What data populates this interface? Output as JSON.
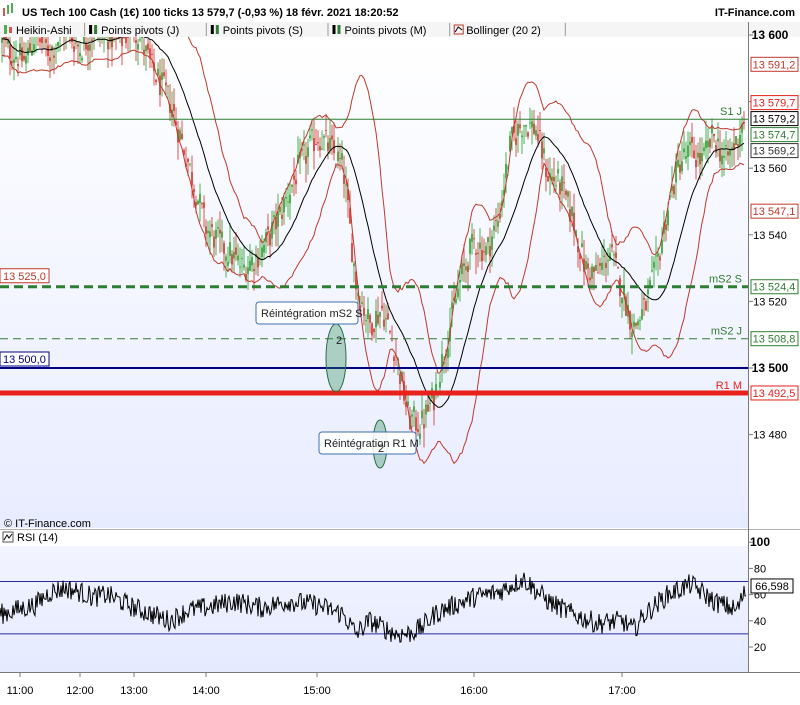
{
  "header": {
    "title": "US Tech 100 Cash (1€) 100 ticks 13 579,7 (-0,93 %) 18 févr. 2021 18:20:52",
    "brand": "IT-Finance.com"
  },
  "legend": [
    {
      "label": "Heikin-Ashi",
      "icon": "heikin-ashi-icon",
      "color": "#2e9e2e"
    },
    {
      "label": "Points pivots (J)",
      "icon": "pivot-icon",
      "color": "#2e7d32"
    },
    {
      "label": "Points pivots (S)",
      "icon": "pivot-icon",
      "color": "#2e7d32"
    },
    {
      "label": "Points pivots (M)",
      "icon": "pivot-icon",
      "color": "#2e7d32"
    },
    {
      "label": "Bollinger (20 2)",
      "icon": "bollinger-icon",
      "color": "#c0392b"
    }
  ],
  "watermark": "© IT-Finance.com",
  "colors": {
    "bull": "#4caf50",
    "bear": "#d9534f",
    "bollinger": "#c0392b",
    "middle": "#000000",
    "pivot_green": "#2e7d32",
    "navy": "#000080",
    "red_level": "#e8211b",
    "plot_bg_top": "#ffffff",
    "plot_bg_bottom": "#e8ecff"
  },
  "chart_data": [
    {
      "type": "candlestick",
      "title": "US Tech 100 Cash (1€) 100 ticks",
      "x_ticks": [
        "11:00",
        "12:00",
        "13:00",
        "14:00",
        "15:00",
        "16:00",
        "17:00"
      ],
      "y_range": [
        13460,
        13610
      ],
      "y_ticks": [
        13480,
        13500,
        13520,
        13540,
        13560,
        13580,
        13600
      ],
      "y_tick_labels": [
        "13 480",
        "13 500",
        "13 520",
        "13 540",
        "13 560",
        "13 580",
        "13 600"
      ],
      "last_price": 13579.7,
      "price_tags": [
        {
          "label": "13 591,2",
          "value": 13591.2,
          "type": "bollinger-upper"
        },
        {
          "label": "13 579,7",
          "value": 13579.7,
          "type": "last-price"
        },
        {
          "label": "13 579,2",
          "value": 13579.2,
          "type": "bollinger-middle"
        },
        {
          "label": "13 574,7",
          "value": 13574.7,
          "type": "pivot"
        },
        {
          "label": "13 569,2",
          "value": 13569.2,
          "type": "price"
        },
        {
          "label": "13 547,1",
          "value": 13547.1,
          "type": "bollinger-lower"
        },
        {
          "label": "13 524,4",
          "value": 13524.4,
          "type": "pivot"
        },
        {
          "label": "13 508,8",
          "value": 13508.8,
          "type": "pivot"
        },
        {
          "label": "13 492,5",
          "value": 13492.5,
          "type": "pivot"
        }
      ],
      "levels": [
        {
          "name": "S1 J",
          "value": 13574.7,
          "style": "solid-green"
        },
        {
          "name": "mS2 S",
          "value": 13524.4,
          "style": "thick-dashed-green"
        },
        {
          "name": "mS2 J",
          "value": 13508.8,
          "style": "dashed-green"
        },
        {
          "name": "R1 M",
          "value": 13492.5,
          "style": "thick-red"
        },
        {
          "name": "",
          "value": 13500.0,
          "style": "navy"
        }
      ],
      "level_tags_left": [
        {
          "label": "13 525,0",
          "value": 13525.0
        },
        {
          "label": "13 500,0",
          "value": 13500.0
        }
      ],
      "annotations": [
        {
          "text": "Réintégration mS2 S",
          "count": "2"
        },
        {
          "text": "Réintégration R1 M",
          "count": "2"
        }
      ],
      "price_path": [
        [
          "10:55",
          13598
        ],
        [
          "11:05",
          13592
        ],
        [
          "11:15",
          13600
        ],
        [
          "11:30",
          13595
        ],
        [
          "11:45",
          13602
        ],
        [
          "12:00",
          13596
        ],
        [
          "12:15",
          13601
        ],
        [
          "12:30",
          13600
        ],
        [
          "12:45",
          13598
        ],
        [
          "13:00",
          13603
        ],
        [
          "13:15",
          13590
        ],
        [
          "13:30",
          13580
        ],
        [
          "13:45",
          13562
        ],
        [
          "14:00",
          13542
        ],
        [
          "14:10",
          13536
        ],
        [
          "14:20",
          13530
        ],
        [
          "14:30",
          13535
        ],
        [
          "14:40",
          13546
        ],
        [
          "14:50",
          13560
        ],
        [
          "15:00",
          13570
        ],
        [
          "15:05",
          13566
        ],
        [
          "15:10",
          13560
        ],
        [
          "15:15",
          13525
        ],
        [
          "15:20",
          13513
        ],
        [
          "15:25",
          13518
        ],
        [
          "15:30",
          13505
        ],
        [
          "15:35",
          13485
        ],
        [
          "15:40",
          13483
        ],
        [
          "15:45",
          13492
        ],
        [
          "15:50",
          13510
        ],
        [
          "15:55",
          13527
        ],
        [
          "16:00",
          13538
        ],
        [
          "16:05",
          13535
        ],
        [
          "16:10",
          13545
        ],
        [
          "16:15",
          13568
        ],
        [
          "16:20",
          13574
        ],
        [
          "16:25",
          13572
        ],
        [
          "16:30",
          13558
        ],
        [
          "16:35",
          13555
        ],
        [
          "16:40",
          13545
        ],
        [
          "16:45",
          13530
        ],
        [
          "16:50",
          13528
        ],
        [
          "16:55",
          13535
        ],
        [
          "17:00",
          13524
        ],
        [
          "17:05",
          13512
        ],
        [
          "17:10",
          13518
        ],
        [
          "17:15",
          13530
        ],
        [
          "17:20",
          13548
        ],
        [
          "17:25",
          13562
        ],
        [
          "17:30",
          13565
        ],
        [
          "17:35",
          13562
        ],
        [
          "17:40",
          13570
        ],
        [
          "17:45",
          13562
        ],
        [
          "17:50",
          13568
        ],
        [
          "17:55",
          13579.7
        ]
      ]
    },
    {
      "type": "line",
      "title": "RSI (14)",
      "y_range": [
        10,
        105
      ],
      "y_ticks": [
        20,
        40,
        60,
        80,
        100
      ],
      "y_tick_labels": [
        "20",
        "40",
        "60",
        "80",
        "100"
      ],
      "bands": [
        30,
        70
      ],
      "last_value_label": "66,598",
      "last_value": 66.598,
      "anchors": [
        [
          "10:55",
          45
        ],
        [
          "11:15",
          52
        ],
        [
          "11:30",
          62
        ],
        [
          "11:45",
          65
        ],
        [
          "12:00",
          62
        ],
        [
          "12:15",
          58
        ],
        [
          "12:30",
          60
        ],
        [
          "12:45",
          55
        ],
        [
          "13:00",
          50
        ],
        [
          "13:15",
          45
        ],
        [
          "13:30",
          40
        ],
        [
          "13:45",
          48
        ],
        [
          "14:00",
          50
        ],
        [
          "14:15",
          55
        ],
        [
          "14:30",
          50
        ],
        [
          "14:45",
          55
        ],
        [
          "15:00",
          52
        ],
        [
          "15:10",
          45
        ],
        [
          "15:15",
          30
        ],
        [
          "15:20",
          40
        ],
        [
          "15:25",
          35
        ],
        [
          "15:30",
          30
        ],
        [
          "15:35",
          30
        ],
        [
          "15:40",
          35
        ],
        [
          "15:45",
          45
        ],
        [
          "15:50",
          50
        ],
        [
          "16:00",
          58
        ],
        [
          "16:10",
          62
        ],
        [
          "16:20",
          72
        ],
        [
          "16:30",
          55
        ],
        [
          "16:40",
          45
        ],
        [
          "16:50",
          38
        ],
        [
          "17:00",
          40
        ],
        [
          "17:05",
          33
        ],
        [
          "17:10",
          45
        ],
        [
          "17:20",
          60
        ],
        [
          "17:30",
          68
        ],
        [
          "17:40",
          55
        ],
        [
          "17:50",
          48
        ],
        [
          "17:55",
          66.6
        ]
      ]
    }
  ]
}
